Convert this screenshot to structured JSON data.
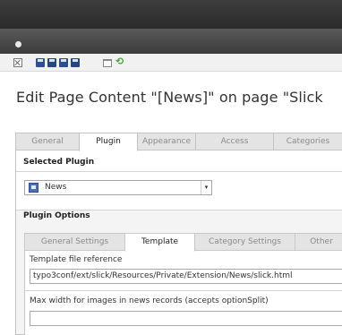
{
  "page": {
    "title": "Edit Page Content \"[News]\" on page \"Slick"
  },
  "toolbar": {
    "icons": [
      "close-icon",
      "save-icon",
      "save-view-icon",
      "save-new-icon",
      "save-close-icon",
      "delete-icon",
      "undo-icon"
    ]
  },
  "tabs": [
    {
      "label": "General",
      "active": false
    },
    {
      "label": "Plugin",
      "active": true
    },
    {
      "label": "Appearance",
      "active": false
    },
    {
      "label": "Access",
      "active": false
    },
    {
      "label": "Categories",
      "active": false
    }
  ],
  "plugin": {
    "selected_heading": "Selected Plugin",
    "selected_value": "News",
    "options_heading": "Plugin Options"
  },
  "subtabs": [
    {
      "label": "General Settings",
      "active": false
    },
    {
      "label": "Template",
      "active": true
    },
    {
      "label": "Category Settings",
      "active": false
    },
    {
      "label": "Other",
      "active": false
    }
  ],
  "fields": {
    "template_label": "Template file reference",
    "template_value": "typo3conf/ext/slick/Resources/Private/Extension/News/slick.html",
    "maxwidth_label": "Max width for images in news records (accepts optionSplit)",
    "maxwidth_value": ""
  },
  "colors": {
    "topbar": "#2f2f2f",
    "tab_inactive": "#e4e4e4",
    "undo": "#4aa23a",
    "save": "#2c4f95"
  }
}
